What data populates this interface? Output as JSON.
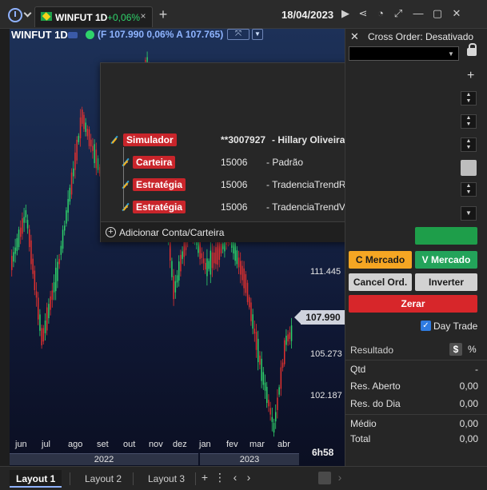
{
  "topbar": {
    "tab_symbol": "WINFUT 1D",
    "tab_change": "+0,06%",
    "tab_close": "×",
    "add_tab": "+",
    "date": "18/04/2023",
    "icons": [
      "play-icon",
      "share-icon",
      "clock-icon",
      "expand-icon",
      "minimize-icon",
      "maximize-icon",
      "close-icon"
    ]
  },
  "chart": {
    "symbol": "WINFUT 1D",
    "quote": "(F 107.990 0,06% A 107.765)",
    "price_ticks": [
      "111.445",
      "105.273",
      "102.187"
    ],
    "price_tag": "107.990",
    "months": [
      "jun",
      "jul",
      "ago",
      "set",
      "out",
      "nov",
      "dez",
      "jan",
      "fev",
      "mar",
      "abr"
    ],
    "years": [
      "2022",
      "2023"
    ],
    "timer": "6h58"
  },
  "popup": {
    "rows": [
      {
        "badge": "Simulador",
        "id": "**3007927",
        "name": "- Hillary Oliveira Coimbra"
      },
      {
        "badge": "Carteira",
        "id": "15006",
        "name": "- Padrão"
      },
      {
        "badge": "Estratégia",
        "id": "15006",
        "name": "- TradenciaTrendReturn"
      },
      {
        "badge": "Estratégia",
        "id": "15006",
        "name": "- TradenciaTrendVariat"
      }
    ],
    "add_label": "Adicionar Conta/Carteira"
  },
  "panel": {
    "cross_order": "Cross Order: Desativado",
    "buttons": {
      "c_mercado": "C Mercado",
      "v_mercado": "V Mercado",
      "cancel": "Cancel Ord.",
      "inverter": "Inverter",
      "zerar": "Zerar"
    },
    "day_trade": "Day Trade",
    "resultado": "Resultado",
    "dollar": "$",
    "percent": "%",
    "rows": [
      {
        "k": "Qtd",
        "v": "-"
      },
      {
        "k": "Res. Aberto",
        "v": "0,00"
      },
      {
        "k": "Res. do Dia",
        "v": "0,00"
      },
      {
        "k": "Médio",
        "v": "0,00"
      },
      {
        "k": "Total",
        "v": "0,00"
      }
    ]
  },
  "bottombar": {
    "layouts": [
      "Layout 1",
      "Layout 2",
      "Layout 3"
    ],
    "add": "+",
    "more": "⋮"
  },
  "colors": {
    "up": "#2fd36b",
    "down": "#e0312f",
    "accent": "#8fb2ff",
    "badge_red": "#c9252b"
  }
}
